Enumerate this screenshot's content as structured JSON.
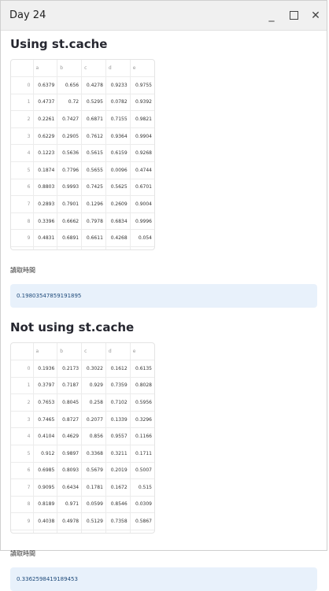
{
  "window": {
    "title": "Day 24",
    "minimize_glyph": "_",
    "close_glyph": "✕"
  },
  "sections": [
    {
      "heading": "Using st.cache",
      "columns": [
        "",
        "a",
        "b",
        "c",
        "d",
        "e"
      ],
      "rows": [
        [
          "0",
          "0.6379",
          "0.656",
          "0.4278",
          "0.9233",
          "0.9755"
        ],
        [
          "1",
          "0.4737",
          "0.72",
          "0.5295",
          "0.0782",
          "0.9392"
        ],
        [
          "2",
          "0.2261",
          "0.7427",
          "0.6871",
          "0.7155",
          "0.9821"
        ],
        [
          "3",
          "0.6229",
          "0.2905",
          "0.7612",
          "0.9364",
          "0.9904"
        ],
        [
          "4",
          "0.1223",
          "0.5636",
          "0.5615",
          "0.6159",
          "0.9268"
        ],
        [
          "5",
          "0.1874",
          "0.7796",
          "0.5655",
          "0.0096",
          "0.4744"
        ],
        [
          "6",
          "0.8803",
          "0.9993",
          "0.7425",
          "0.5625",
          "0.6701"
        ],
        [
          "7",
          "0.2893",
          "0.7901",
          "0.1296",
          "0.2609",
          "0.9004"
        ],
        [
          "8",
          "0.3396",
          "0.6662",
          "0.7978",
          "0.6834",
          "0.9996"
        ],
        [
          "9",
          "0.4831",
          "0.6891",
          "0.6611",
          "0.4268",
          "0.054"
        ]
      ],
      "time_label": "讀取時間",
      "time_value": "0.19803547859191895"
    },
    {
      "heading": "Not using st.cache",
      "columns": [
        "",
        "a",
        "b",
        "c",
        "d",
        "e"
      ],
      "rows": [
        [
          "0",
          "0.1936",
          "0.2173",
          "0.3022",
          "0.1612",
          "0.6135"
        ],
        [
          "1",
          "0.3797",
          "0.7187",
          "0.929",
          "0.7359",
          "0.8028"
        ],
        [
          "2",
          "0.7653",
          "0.8045",
          "0.258",
          "0.7102",
          "0.5956"
        ],
        [
          "3",
          "0.7465",
          "0.8727",
          "0.2077",
          "0.1339",
          "0.3296"
        ],
        [
          "4",
          "0.4104",
          "0.4629",
          "0.856",
          "0.9557",
          "0.1166"
        ],
        [
          "5",
          "0.912",
          "0.9897",
          "0.3368",
          "0.3211",
          "0.1711"
        ],
        [
          "6",
          "0.6985",
          "0.8093",
          "0.5679",
          "0.2019",
          "0.5007"
        ],
        [
          "7",
          "0.9095",
          "0.6434",
          "0.1781",
          "0.1672",
          "0.515"
        ],
        [
          "8",
          "0.8189",
          "0.971",
          "0.0599",
          "0.8546",
          "0.0309"
        ],
        [
          "9",
          "0.4038",
          "0.4978",
          "0.5129",
          "0.7358",
          "0.5867"
        ]
      ],
      "time_label": "讀取時間",
      "time_value": "0.3362598419189453"
    }
  ]
}
